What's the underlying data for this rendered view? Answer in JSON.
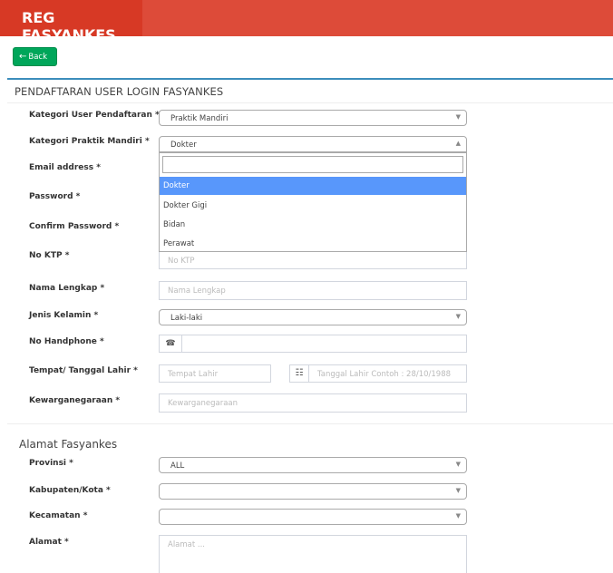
{
  "header": {
    "brand": "REG FASYANKES"
  },
  "back_button": {
    "icon": "arrow-left-icon",
    "label": "Back"
  },
  "form": {
    "title": "PENDAFTARAN USER LOGIN FASYANKES",
    "kategori_user": {
      "label": "Kategori User Pendaftaran *",
      "value": "Praktik Mandiri"
    },
    "kategori_praktik": {
      "label": "Kategori Praktik Mandiri *",
      "value": "Dokter",
      "options": [
        "Dokter",
        "Dokter Gigi",
        "Bidan",
        "Perawat"
      ]
    },
    "email": {
      "label": "Email address *"
    },
    "password": {
      "label": "Password *"
    },
    "confirm_password": {
      "label": "Confirm Password *"
    },
    "ktp": {
      "label": "No KTP *",
      "placeholder": "No KTP"
    },
    "nama": {
      "label": "Nama Lengkap *",
      "placeholder": "Nama Lengkap"
    },
    "jenis_kelamin": {
      "label": "Jenis Kelamin *",
      "value": "Laki-laki"
    },
    "handphone": {
      "label": "No Handphone *",
      "icon": "phone-icon",
      "value": ""
    },
    "ttl": {
      "label": "Tempat/ Tanggal Lahir *",
      "tempat_placeholder": "Tempat Lahir",
      "calendar_icon": "calendar-icon",
      "tanggal_placeholder": "Tanggal Lahir Contoh : 28/10/1988"
    },
    "kewarganegaraan": {
      "label": "Kewarganegaraan *",
      "placeholder": "Kewarganegaraan"
    }
  },
  "alamat": {
    "title": "Alamat Fasyankes",
    "provinsi": {
      "label": "Provinsi *",
      "value": "ALL"
    },
    "kabupaten": {
      "label": "Kabupaten/Kota *",
      "value": ""
    },
    "kecamatan": {
      "label": "Kecamatan *",
      "value": ""
    },
    "alamat": {
      "label": "Alamat *",
      "placeholder": "Alamat ..."
    }
  },
  "colors": {
    "header": "#dd4b39",
    "brand": "#d73925",
    "back_button": "#00a65a",
    "box_border": "#3c8dbc",
    "dropdown_highlight": "#5897fb"
  }
}
